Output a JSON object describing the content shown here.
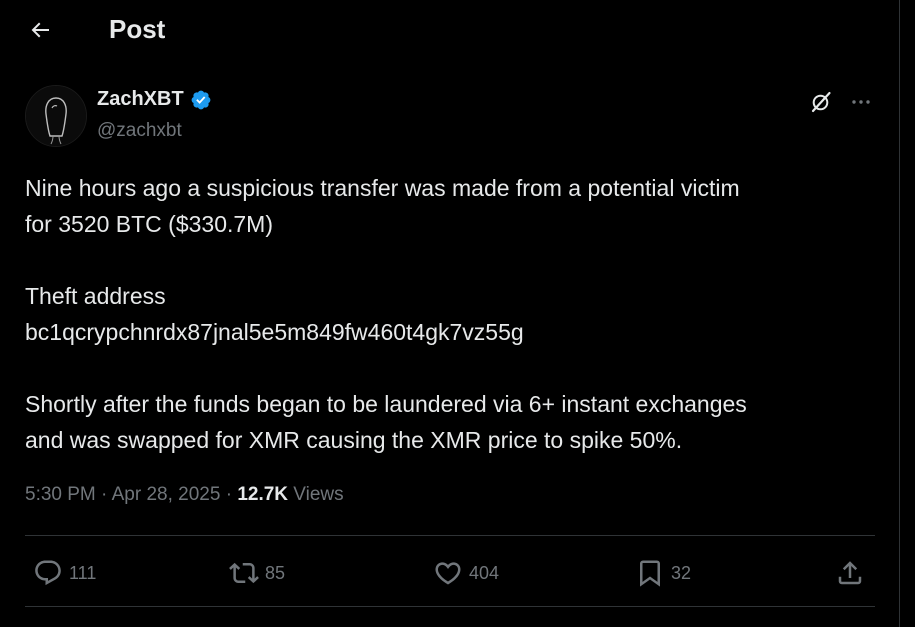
{
  "header": {
    "title": "Post"
  },
  "author": {
    "name": "ZachXBT",
    "handle": "@zachxbt",
    "verified": true
  },
  "tweet": {
    "line1": "Nine hours ago a suspicious transfer was made from a potential victim",
    "line2": "for 3520 BTC ($330.7M)",
    "line3": "Theft address",
    "line4": "bc1qcrypchnrdx87jnal5e5m849fw460t4gk7vz55g",
    "line5": "Shortly after the funds began to be laundered via 6+ instant exchanges",
    "line6": "and was swapped for XMR causing the XMR price to spike 50%."
  },
  "meta": {
    "time": "5:30 PM",
    "separator": "·",
    "date": "Apr 28, 2025",
    "views_count": "12.7K",
    "views_label": "Views"
  },
  "actions": {
    "replies": "111",
    "reposts": "85",
    "likes": "404",
    "bookmarks": "32"
  },
  "icons": {
    "back": "arrow-left-icon",
    "verified": "verified-badge-icon",
    "grok": "grok-icon",
    "more": "more-icon",
    "reply": "reply-icon",
    "repost": "repost-icon",
    "like": "heart-icon",
    "bookmark": "bookmark-icon",
    "share": "share-icon"
  },
  "colors": {
    "background": "#000000",
    "text_primary": "#e7e9ea",
    "text_secondary": "#71767b",
    "border": "#2f3336",
    "verified_blue": "#1d9bf0"
  }
}
